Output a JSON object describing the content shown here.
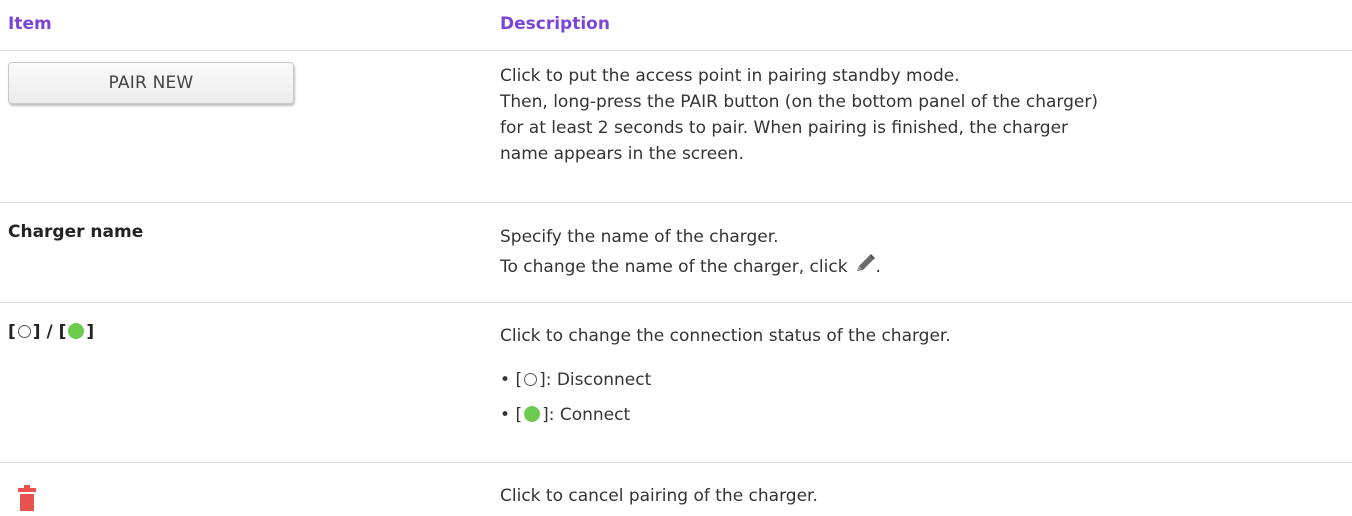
{
  "header": {
    "item": "Item",
    "description": "Description"
  },
  "rows": [
    {
      "button_label": "PAIR NEW",
      "description_lines": [
        "Click to put the access point in pairing standby mode.",
        "Then, long-press the PAIR button (on the bottom panel of the charger)",
        "for at least 2 seconds to pair. When pairing is finished, the charger",
        "name appears in the screen."
      ]
    },
    {
      "item": "Charger name",
      "line1": "Specify the name of the charger.",
      "line2": "To change the name of the charger, click",
      "line2_suffix": ".",
      "icon": "pencil-icon"
    },
    {
      "item_open": "[",
      "item_mid": "] / [",
      "item_close": "]",
      "description": "Click to change the connection status of the charger.",
      "bullets": [
        {
          "bullet": "•",
          "open": "[",
          "close": "]: Disconnect",
          "icon": "empty-circle-icon"
        },
        {
          "bullet": "•",
          "open": "[",
          "close": "]: Connect",
          "icon": "green-circle-icon"
        }
      ]
    },
    {
      "icon": "trash-icon",
      "description": "Click to cancel pairing of the charger."
    }
  ],
  "colors": {
    "header_text": "#7b45d6",
    "divider": "#d8d8e8",
    "connected": "#6ccb4f",
    "trash": "#e8534f"
  }
}
